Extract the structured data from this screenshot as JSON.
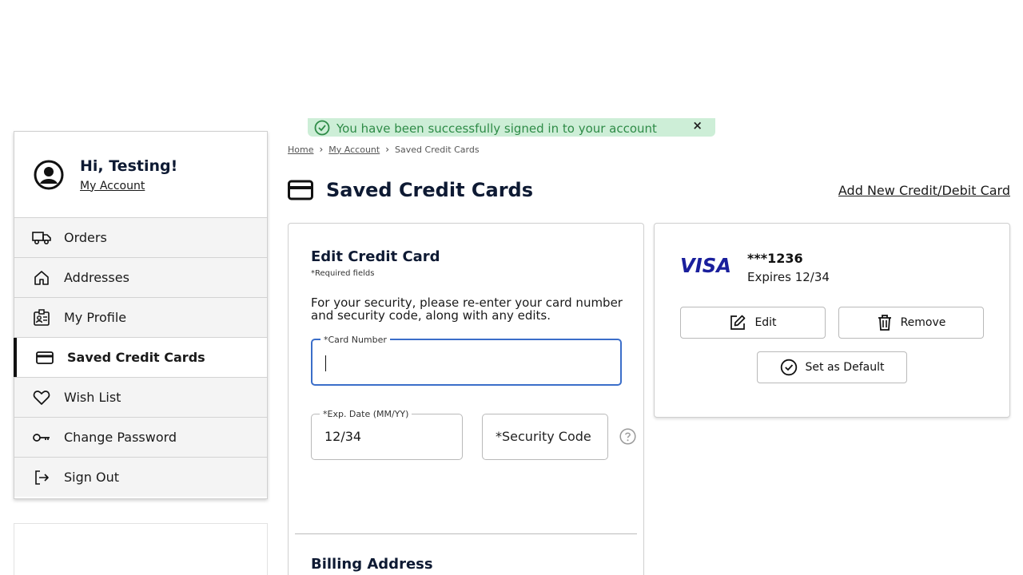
{
  "toast": {
    "message": "You have been successfully signed in to your account",
    "close": "×"
  },
  "sidebar": {
    "greeting": "Hi, Testing!",
    "account_link": "My Account",
    "items": [
      {
        "label": "Orders",
        "icon": "truck-icon"
      },
      {
        "label": "Addresses",
        "icon": "home-icon"
      },
      {
        "label": "My Profile",
        "icon": "profile-badge-icon"
      },
      {
        "label": "Saved Credit Cards",
        "icon": "credit-card-icon",
        "active": true
      },
      {
        "label": "Wish List",
        "icon": "heart-icon"
      },
      {
        "label": "Change Password",
        "icon": "key-icon"
      },
      {
        "label": "Sign Out",
        "icon": "sign-out-icon"
      }
    ]
  },
  "breadcrumb": {
    "home": "Home",
    "account": "My Account",
    "current": "Saved Credit Cards"
  },
  "page": {
    "title": "Saved Credit Cards",
    "add_link": "Add New Credit/Debit Card"
  },
  "edit_form": {
    "title": "Edit Credit Card",
    "required_note": "*Required fields",
    "security_note": "For your security, please re-enter your card number and security code, along with any edits.",
    "card_number_label": "*Card Number",
    "card_number_value": "",
    "exp_label": "*Exp. Date (MM/YY)",
    "exp_value": "12/34",
    "security_placeholder": "*Security Code",
    "billing_title": "Billing Address"
  },
  "saved_card": {
    "brand": "VISA",
    "masked_number": "***1236",
    "expires": "Expires 12/34",
    "edit_label": "Edit",
    "remove_label": "Remove",
    "default_label": "Set as Default"
  },
  "colors": {
    "toast_bg": "#cdeed7",
    "toast_text": "#2e8b47",
    "visa_blue": "#1a1f9c",
    "focus_border": "#3b6ec9",
    "heading": "#0e1a33"
  }
}
